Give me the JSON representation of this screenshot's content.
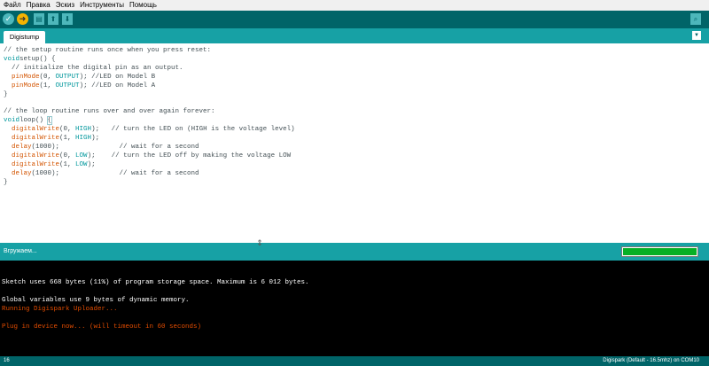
{
  "menu": [
    "Файл",
    "Правка",
    "Эскиз",
    "Инструменты",
    "Помощь"
  ],
  "toolbar": {
    "icons": [
      "verify-icon",
      "upload-icon",
      "new-icon",
      "open-icon",
      "save-icon",
      "serial-monitor-icon"
    ],
    "verify_glyph": "✓",
    "upload_glyph": "➜",
    "new_glyph": "▤",
    "open_glyph": "⬆",
    "save_glyph": "⬇",
    "serial_glyph": "⌕"
  },
  "tabs": [
    {
      "label": "Digistump"
    }
  ],
  "tab_menu_glyph": "▼",
  "editor": {
    "lines": [
      [
        [
          "cm",
          "// the setup routine runs once when you press reset:"
        ]
      ],
      [
        [
          "kw",
          "void"
        ],
        [
          "",
          "setup() {"
        ]
      ],
      [
        [
          "cm",
          "  // initialize the digital pin as an output."
        ]
      ],
      [
        [
          "",
          "  "
        ],
        [
          "fn",
          "pinMode"
        ],
        [
          "",
          "(0, "
        ],
        [
          "ct",
          "OUTPUT"
        ],
        [
          "",
          "); //LED on Model B"
        ]
      ],
      [
        [
          "",
          "  "
        ],
        [
          "fn",
          "pinMode"
        ],
        [
          "",
          "(1, "
        ],
        [
          "ct",
          "OUTPUT"
        ],
        [
          "",
          "); //LED on Model A"
        ]
      ],
      [
        [
          "",
          "}"
        ]
      ],
      [
        [
          "",
          ""
        ]
      ],
      [
        [
          "cm",
          "// the loop routine runs over and over again forever:"
        ]
      ],
      [
        [
          "kw",
          "void"
        ],
        [
          "",
          "loop() "
        ],
        [
          "br",
          "{"
        ]
      ],
      [
        [
          "",
          "  "
        ],
        [
          "fn",
          "digitalWrite"
        ],
        [
          "",
          "(0, "
        ],
        [
          "ct",
          "HIGH"
        ],
        [
          "",
          ");   // turn the LED on (HIGH is the voltage level)"
        ]
      ],
      [
        [
          "",
          "  "
        ],
        [
          "fn",
          "digitalWrite"
        ],
        [
          "",
          "(1, "
        ],
        [
          "ct",
          "HIGH"
        ],
        [
          "",
          ");"
        ]
      ],
      [
        [
          "",
          "  "
        ],
        [
          "fn",
          "delay"
        ],
        [
          "",
          "(1000);               // wait for a second"
        ]
      ],
      [
        [
          "",
          "  "
        ],
        [
          "fn",
          "digitalWrite"
        ],
        [
          "",
          "(0, "
        ],
        [
          "ct",
          "LOW"
        ],
        [
          "",
          ");    // turn the LED off by making the voltage LOW"
        ]
      ],
      [
        [
          "",
          "  "
        ],
        [
          "fn",
          "digitalWrite"
        ],
        [
          "",
          "(1, "
        ],
        [
          "ct",
          "LOW"
        ],
        [
          "",
          ");"
        ]
      ],
      [
        [
          "",
          "  "
        ],
        [
          "fn",
          "delay"
        ],
        [
          "",
          "(1000);               // wait for a second"
        ]
      ],
      [
        [
          "",
          "}"
        ]
      ]
    ]
  },
  "status": {
    "text": "Вгружаем...",
    "progress": 1.0
  },
  "console": {
    "lines": [
      {
        "text": "Sketch uses 668 bytes (11%) of program storage space. Maximum is 6 012 bytes.",
        "type": "normal"
      },
      {
        "text": "",
        "type": "normal"
      },
      {
        "text": "Global variables use 9 bytes of dynamic memory.",
        "type": "normal"
      },
      {
        "text": "Running Digispark Uploader...",
        "type": "err"
      },
      {
        "text": "",
        "type": "normal"
      },
      {
        "text": "Plug in device now... (will timeout in 60 seconds)",
        "type": "err"
      }
    ]
  },
  "footer": {
    "line": "16",
    "board": "Digispark (Default - 16.5mhz) on COM10"
  },
  "divider_glyph": "⇕"
}
